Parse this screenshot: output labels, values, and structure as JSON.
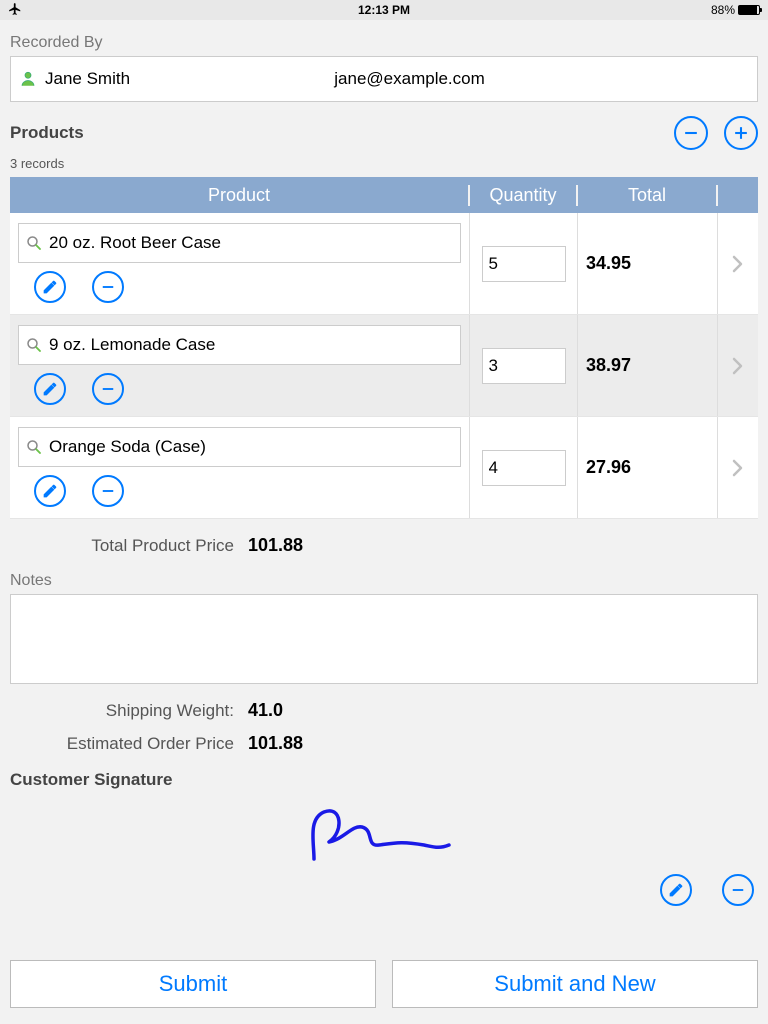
{
  "status": {
    "time": "12:13 PM",
    "battery": "88%"
  },
  "recorded_by": {
    "label": "Recorded By",
    "name": "Jane Smith",
    "email": "jane@example.com"
  },
  "products": {
    "label": "Products",
    "records_count": "3 records",
    "columns": {
      "product": "Product",
      "quantity": "Quantity",
      "total": "Total"
    },
    "rows": [
      {
        "name": "20 oz. Root Beer Case",
        "qty": "5",
        "total": "34.95"
      },
      {
        "name": "9 oz. Lemonade Case",
        "qty": "3",
        "total": "38.97"
      },
      {
        "name": "Orange Soda (Case)",
        "qty": "4",
        "total": "27.96"
      }
    ]
  },
  "summary": {
    "total_product_price_label": "Total Product Price",
    "total_product_price": "101.88",
    "notes_label": "Notes",
    "shipping_label": "Shipping Weight:",
    "shipping_value": "41.0",
    "estimated_label": "Estimated Order Price",
    "estimated_value": "101.88"
  },
  "signature": {
    "label": "Customer Signature"
  },
  "buttons": {
    "submit": "Submit",
    "submit_new": "Submit and New"
  }
}
